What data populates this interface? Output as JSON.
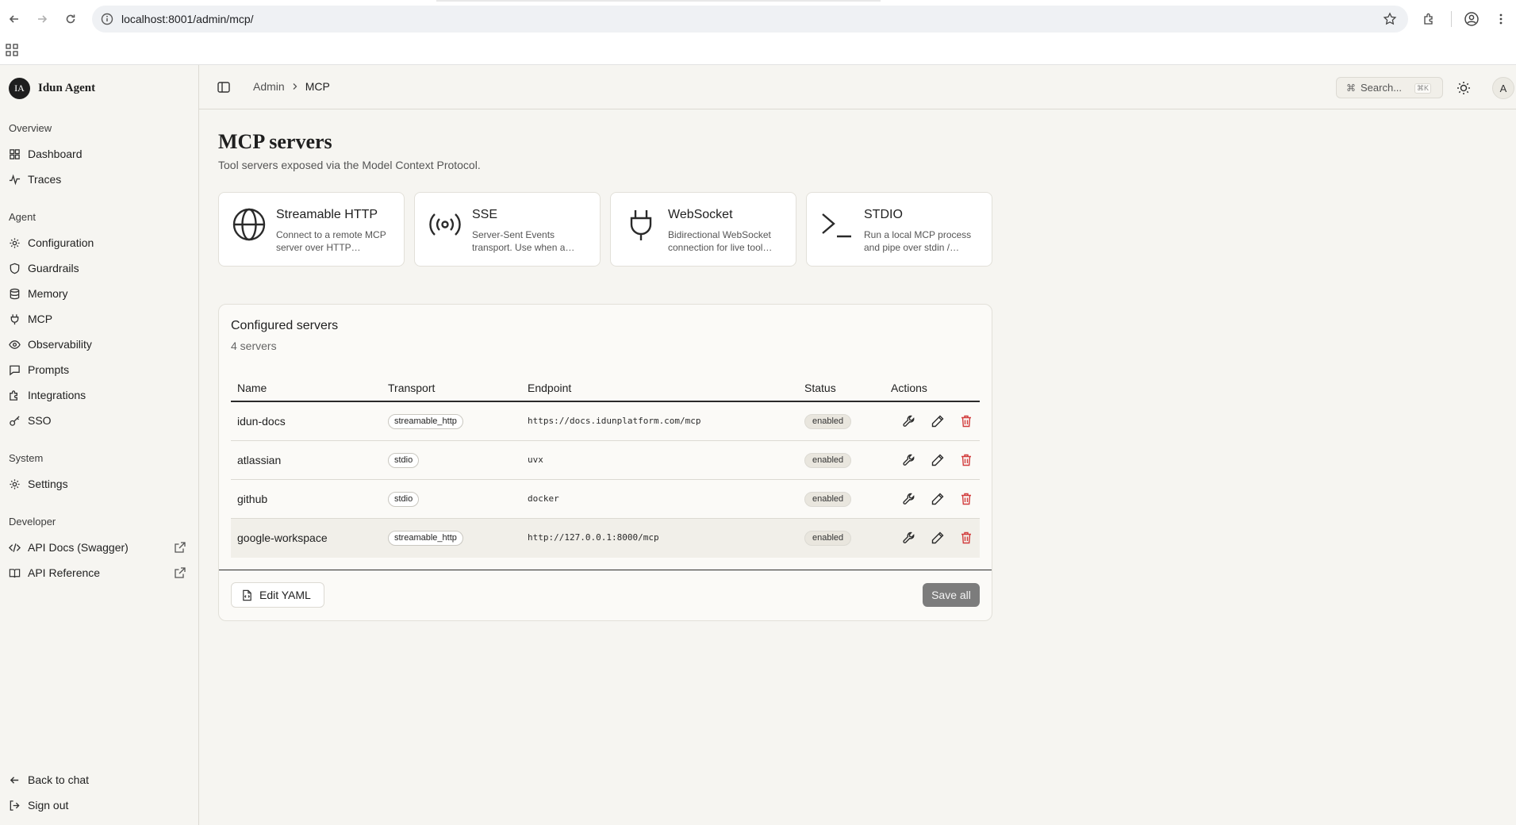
{
  "browser": {
    "url": "localhost:8001/admin/mcp/"
  },
  "sidebar": {
    "brand_initials": "IA",
    "brand_name": "Idun Agent",
    "groups": {
      "overview": "Overview",
      "agent": "Agent",
      "system": "System",
      "developer": "Developer"
    },
    "items": {
      "dashboard": "Dashboard",
      "traces": "Traces",
      "configuration": "Configuration",
      "guardrails": "Guardrails",
      "memory": "Memory",
      "mcp": "MCP",
      "observability": "Observability",
      "prompts": "Prompts",
      "integrations": "Integrations",
      "sso": "SSO",
      "settings": "Settings",
      "api_docs": "API Docs (Swagger)",
      "api_reference": "API Reference",
      "back_to_chat": "Back to chat",
      "sign_out": "Sign out"
    }
  },
  "topbar": {
    "breadcrumb_parent": "Admin",
    "breadcrumb_current": "MCP",
    "search_placeholder": "Search...",
    "search_shortcut": "⌘K",
    "avatar_initial": "A"
  },
  "page": {
    "title": "MCP servers",
    "subtitle": "Tool servers exposed via the Model Context Protocol."
  },
  "transports": [
    {
      "title": "Streamable HTTP",
      "desc": "Connect to a remote MCP server over HTTP…",
      "icon": "globe-icon"
    },
    {
      "title": "SSE",
      "desc": "Server-Sent Events transport. Use when a…",
      "icon": "broadcast-icon"
    },
    {
      "title": "WebSocket",
      "desc": "Bidirectional WebSocket connection for live tool…",
      "icon": "plug-icon"
    },
    {
      "title": "STDIO",
      "desc": "Run a local MCP process and pipe over stdin /…",
      "icon": "terminal-icon"
    }
  ],
  "servers_panel": {
    "title": "Configured servers",
    "count": "4 servers",
    "columns": {
      "name": "Name",
      "transport": "Transport",
      "endpoint": "Endpoint",
      "status": "Status",
      "actions": "Actions"
    },
    "rows": [
      {
        "name": "idun-docs",
        "transport": "streamable_http",
        "endpoint": "https://docs.idunplatform.com/mcp",
        "status": "enabled"
      },
      {
        "name": "atlassian",
        "transport": "stdio",
        "endpoint": "uvx",
        "status": "enabled"
      },
      {
        "name": "github",
        "transport": "stdio",
        "endpoint": "docker",
        "status": "enabled"
      },
      {
        "name": "google-workspace",
        "transport": "streamable_http",
        "endpoint": "http://127.0.0.1:8000/mcp",
        "status": "enabled"
      }
    ],
    "edit_yaml_label": "Edit YAML",
    "save_all_label": "Save all"
  },
  "colors": {
    "delete": "#d23c3c",
    "save_disabled": "#7c7c7c",
    "background": "#f6f5f1"
  }
}
